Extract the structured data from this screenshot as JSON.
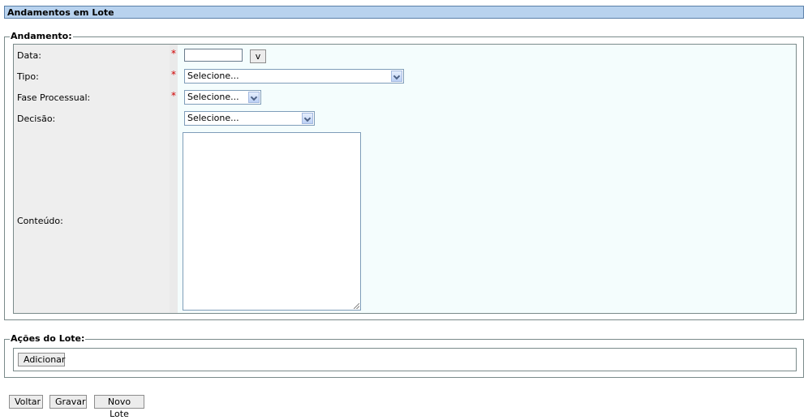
{
  "page": {
    "title": "Andamentos em Lote"
  },
  "andamento": {
    "legend": "Andamento:",
    "required_mark": "*",
    "data": {
      "label": "Data:",
      "value": "",
      "picker_label": "v"
    },
    "tipo": {
      "label": "Tipo:",
      "selected": "Selecione..."
    },
    "fase": {
      "label": "Fase Processual:",
      "selected": "Selecione..."
    },
    "decisao": {
      "label": "Decisão:",
      "selected": "Selecione..."
    },
    "conteudo": {
      "label": "Conteúdo:",
      "value": ""
    }
  },
  "acoes": {
    "legend": "Ações do Lote:",
    "add_label": "Adicionar"
  },
  "footer": {
    "voltar_label": "Voltar",
    "gravar_label": "Gravar",
    "novo_lote_label": "Novo Lote"
  },
  "colors": {
    "titlebar": "#b8d2ee",
    "label_bg": "#eeeeee",
    "field_bg": "#f4fdfd",
    "required": "#d00000"
  },
  "icons": {
    "select_arrow": "chevron-down-icon",
    "resize_grip": "resize-grip-icon"
  }
}
